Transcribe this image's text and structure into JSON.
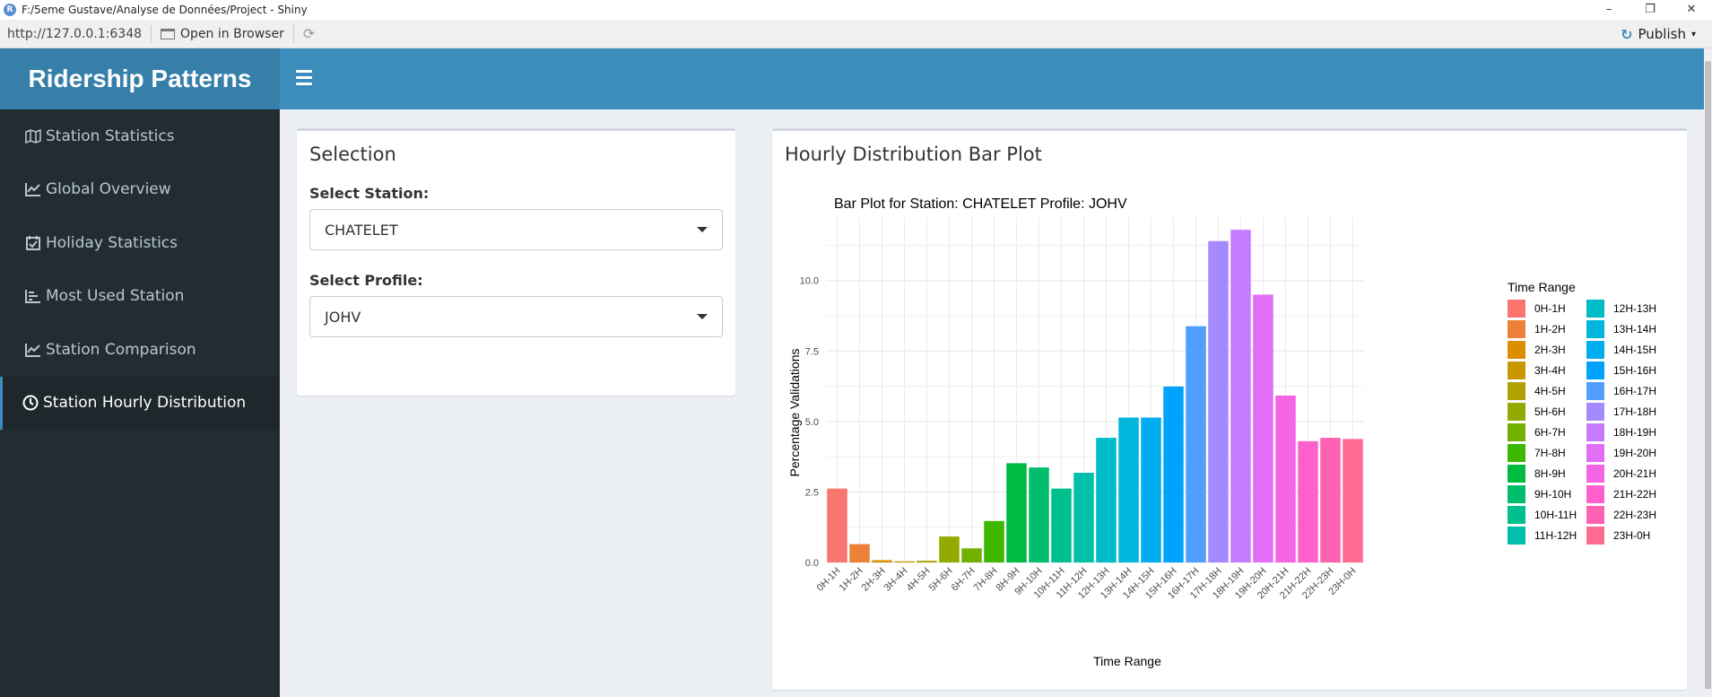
{
  "window": {
    "title": "F:/5eme Gustave/Analyse de Données/Project - Shiny",
    "app_icon_letter": "R",
    "url": "http://127.0.0.1:6348",
    "open_in_browser": "Open in Browser",
    "publish": "Publish"
  },
  "header": {
    "app_title": "Ridership Patterns"
  },
  "sidebar": {
    "items": [
      {
        "label": "Station Statistics",
        "icon": "map-icon"
      },
      {
        "label": "Global Overview",
        "icon": "line-chart-icon"
      },
      {
        "label": "Holiday Statistics",
        "icon": "calendar-check-icon"
      },
      {
        "label": "Most Used Station",
        "icon": "bar-list-icon"
      },
      {
        "label": "Station Comparison",
        "icon": "line-chart-icon"
      },
      {
        "label": "Station Hourly Distribution",
        "icon": "clock-icon"
      }
    ],
    "active_index": 5
  },
  "selection": {
    "title": "Selection",
    "station_label": "Select Station:",
    "station_value": "CHATELET",
    "profile_label": "Select Profile:",
    "profile_value": "JOHV"
  },
  "plot_box": {
    "title": "Hourly Distribution Bar Plot"
  },
  "chart_data": {
    "type": "bar",
    "title": "Bar Plot for Station: CHATELET Profile: JOHV",
    "xlabel": "Time Range",
    "ylabel": "Percentage Validations",
    "ylim": [
      0,
      12.25
    ],
    "yticks": [
      "0.0",
      "2.5",
      "5.0",
      "7.5",
      "10.0"
    ],
    "grid": true,
    "legend_title": "Time Range",
    "legend_position": "right",
    "categories": [
      "0H-1H",
      "1H-2H",
      "2H-3H",
      "3H-4H",
      "4H-5H",
      "5H-6H",
      "6H-7H",
      "7H-8H",
      "8H-9H",
      "9H-10H",
      "10H-11H",
      "11H-12H",
      "12H-13H",
      "13H-14H",
      "14H-15H",
      "15H-16H",
      "16H-17H",
      "17H-18H",
      "18H-19H",
      "19H-20H",
      "20H-21H",
      "21H-22H",
      "22H-23H",
      "23H-0H"
    ],
    "values": [
      2.62,
      0.65,
      0.08,
      0.04,
      0.06,
      0.92,
      0.5,
      1.47,
      3.52,
      3.37,
      2.62,
      3.18,
      4.42,
      5.14,
      5.14,
      6.24,
      8.38,
      11.4,
      11.8,
      9.5,
      5.92,
      4.3,
      4.42,
      4.38
    ],
    "colors": [
      "#F8766D",
      "#EC8239",
      "#DB8E00",
      "#C79800",
      "#AFA100",
      "#94AA00",
      "#72B000",
      "#3DB700",
      "#00BA42",
      "#00BE6C",
      "#00C08D",
      "#00C0AB",
      "#00BCC6",
      "#00B6DC",
      "#00AEEF",
      "#00A3FB",
      "#529EFF",
      "#A58AFF",
      "#C77CFF",
      "#E36EF6",
      "#F564E3",
      "#FF61CC",
      "#FF62B2",
      "#FF6C93"
    ]
  }
}
